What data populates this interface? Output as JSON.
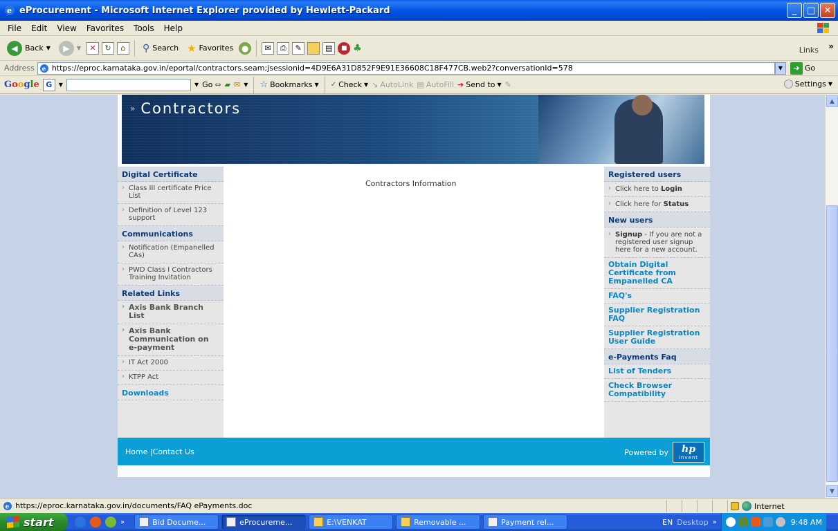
{
  "window": {
    "title": "eProcurement - Microsoft Internet Explorer provided by Hewlett-Packard",
    "min_label": "_",
    "max_label": "□",
    "close_label": "✕"
  },
  "menubar": {
    "items": [
      "File",
      "Edit",
      "View",
      "Favorites",
      "Tools",
      "Help"
    ]
  },
  "toolbar": {
    "back_label": "Back",
    "search_label": "Search",
    "favorites_label": "Favorites",
    "links_label": "Links"
  },
  "address": {
    "label": "Address",
    "url": "https://eproc.karnataka.gov.in/eportal/contractors.seam;jsessionid=4D9E6A31D852F9E91E36608C18F477CB.web2?conversationId=578",
    "go_label": "Go"
  },
  "googlebar": {
    "logo": "Google",
    "go_label": "Go",
    "bookmarks_label": "Bookmarks",
    "check_label": "Check",
    "autolink_label": "AutoLink",
    "autofill_label": "AutoFill",
    "sendto_label": "Send to",
    "settings_label": "Settings"
  },
  "page": {
    "banner_title": "Contractors",
    "center_text": "Contractors Information",
    "left": {
      "digital_certificate_heading": "Digital Certificate",
      "class3": "Class III certificate Price List",
      "definition": "Definition of Level 123 support",
      "communications_heading": "Communications",
      "notification": "Notification (Empanelled CAs)",
      "pwd": "PWD Class I Contractors Training Invitation",
      "related_heading": "Related Links",
      "axis_branch": "Axis Bank Branch List",
      "axis_comm": "Axis Bank Communication on e-payment",
      "it_act": "IT Act 2000",
      "ktpp": "KTPP Act",
      "downloads": "Downloads"
    },
    "right": {
      "registered_heading": "Registered users",
      "login_prefix": "Click here to ",
      "login_bold": "Login",
      "status_prefix": "Click here for ",
      "status_bold": "Status",
      "new_heading": "New users",
      "signup_bold": "Signup",
      "signup_text": " - If you are not a registered user signup here for a new account.",
      "obtain_cert": "Obtain Digital Certificate from Empanelled CA",
      "faqs": "FAQ's",
      "supplier_faq": "Supplier Registration FAQ",
      "supplier_guide": "Supplier Registration User Guide",
      "epayments_heading": "e-Payments Faq",
      "tenders": "List of Tenders",
      "check_browser": "Check Browser Compatibility"
    },
    "footer": {
      "links": "Home |Contact Us",
      "powered_by": "Powered by",
      "hp_logo": "hp",
      "hp_tagline": "invent"
    }
  },
  "statusbar": {
    "text": "https://eproc.karnataka.gov.in/documents/FAQ ePayments.doc",
    "zone": "Internet"
  },
  "taskbar": {
    "start_label": "start",
    "tasks": [
      "Bid Docume...",
      "eProcureme...",
      "E:\\VENKAT",
      "Removable ...",
      "Payment rel..."
    ],
    "lang": "EN",
    "desktop_label": "Desktop",
    "clock": "9:48 AM"
  },
  "colors": {
    "title_bar": "#0055e5",
    "footer": "#0aa0d6",
    "section_heading": "#0d3a74",
    "link": "#0a86c2",
    "start_button": "#3fab3f"
  }
}
